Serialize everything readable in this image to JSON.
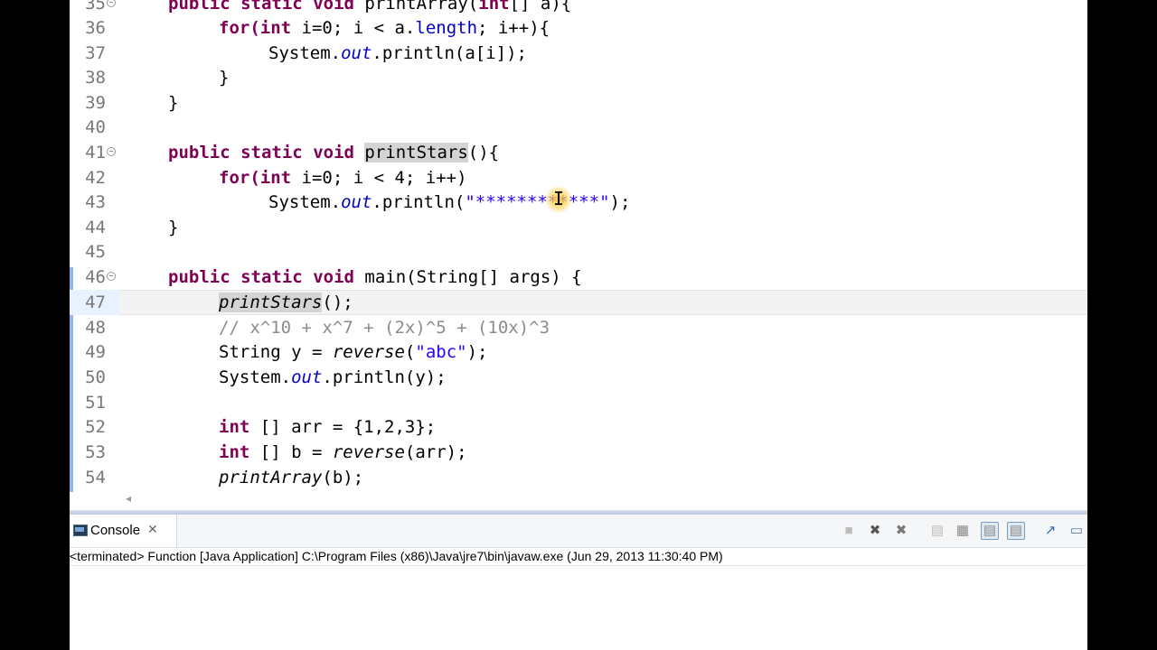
{
  "editor": {
    "lines": [
      {
        "num": "35",
        "fold": true
      },
      {
        "num": "36"
      },
      {
        "num": "37"
      },
      {
        "num": "38"
      },
      {
        "num": "39"
      },
      {
        "num": "40"
      },
      {
        "num": "41",
        "fold": true
      },
      {
        "num": "42"
      },
      {
        "num": "43"
      },
      {
        "num": "44"
      },
      {
        "num": "45"
      },
      {
        "num": "46",
        "fold": true
      },
      {
        "num": "47"
      },
      {
        "num": "48"
      },
      {
        "num": "49"
      },
      {
        "num": "50"
      },
      {
        "num": "51"
      },
      {
        "num": "52"
      },
      {
        "num": "53"
      },
      {
        "num": "54"
      }
    ],
    "tokens": {
      "public": "public",
      "static": "static",
      "void": "void",
      "for": "for(",
      "int": "int",
      "printArray_decl": "printArray(",
      "int_arr_a": "[] a){",
      "i_init": " i=0; i < a.",
      "length": "length",
      "i_inc": "; i++){",
      "system": "System.",
      "out": "out",
      "println_a": ".println(a[i]);",
      "close_brace": "}",
      "printStars": "printStars",
      "paren_open_brace": "(){",
      "i_loop": " i=0; i < 4; i++)",
      "println_open": ".println(",
      "stars": "\"************\"",
      "close_stmt": ");",
      "main_decl": "main(String[] args) {",
      "call_close": "();",
      "comment": "// x^10 + x^7 + (2x)^5 + (10x)^3",
      "string_y": "String y = ",
      "reverse": "reverse",
      "reverse_open": "(",
      "abc": "\"abc\"",
      "println_y": ".println(y);",
      "arr_decl": " [] arr = {1,2,3};",
      "b_decl": " [] b = ",
      "reverse_arr": "(arr);",
      "printArray_call": "printArray",
      "printArray_b": "(b);"
    },
    "scroll_left_marker": "◂"
  },
  "console": {
    "tab_label": "Console",
    "close_glyph": "✕",
    "status": "<terminated> Function [Java Application] C:\\Program Files (x86)\\Java\\jre7\\bin\\javaw.exe (Jun 29, 2013 11:30:40 PM)",
    "toolbar_icons": [
      "terminate-icon",
      "remove-launch-icon",
      "remove-all-terminated-icon",
      "clear-console-icon",
      "scroll-lock-icon",
      "show-on-stdout-icon",
      "show-on-stderr-icon",
      "pin-console-icon",
      "open-console-icon"
    ]
  }
}
